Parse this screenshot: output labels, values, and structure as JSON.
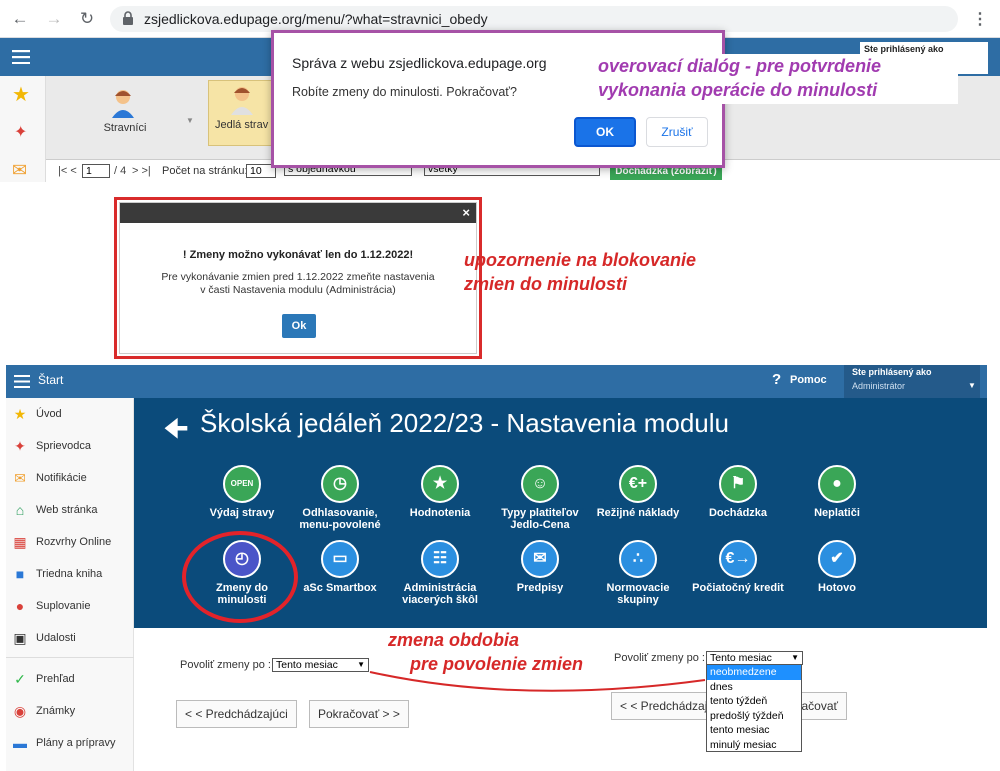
{
  "browser": {
    "url": "zsjedlickova.edupage.org/menu/?what=stravnici_obedy"
  },
  "app_top": {
    "ribbon_stravnici": "Stravníci",
    "ribbon_jedla": "Jedlá strav",
    "pager_nav": "|< <",
    "pager_page": "1",
    "pager_of": "/ 4",
    "pager_next": "> >|",
    "per_page_label": "Počet na stránku:",
    "per_page_value": "10",
    "filter1": "s objednávkou",
    "filter2": "všetky",
    "attendance_button": "Dochádzka (zobraziť)",
    "signed_in_label": "Ste prihlásený ako"
  },
  "confirm_dialog": {
    "title": "Správa z webu zsjedlickova.edupage.org",
    "message": "Robíte zmeny do minulosti. Pokračovať?",
    "ok": "OK",
    "cancel": "Zrušiť"
  },
  "annotations": {
    "confirm_line1": "overovací dialóg - pre potvrdenie",
    "confirm_line2": "vykonania operácie do minulosti",
    "warn_line1": "upozornenie na blokovanie",
    "warn_line2": "zmien do minulosti",
    "zmena_line1": "zmena obdobia",
    "zmena_line2": "pre povolenie zmien"
  },
  "warning_dialog": {
    "title": "! Zmeny možno vykonávať len do 1.12.2022!",
    "line1": "Pre vykonávanie zmien pred 1.12.2022 zmeňte nastavenia",
    "line2": "v časti Nastavenia modulu (Administrácia)",
    "ok": "Ok",
    "close": "×"
  },
  "app2": {
    "menu_label": "Štart",
    "help": "Pomoc",
    "signed_in_label": "Ste prihlásený ako",
    "signed_in_role": "Administrátor",
    "page_title": "Školská jedáleň 2022/23 - Nastavenia modulu",
    "sidebar": [
      {
        "label": "Úvod",
        "icon": "star-icon",
        "color": "#f2b705"
      },
      {
        "label": "Sprievodca",
        "icon": "wand-icon",
        "color": "#d9413a"
      },
      {
        "label": "Notifikácie",
        "icon": "envelope-icon",
        "color": "#f0a030"
      },
      {
        "label": "Web stránka",
        "icon": "home-icon",
        "color": "#2a9d5c"
      },
      {
        "label": "Rozvrhy Online",
        "icon": "grid-icon",
        "color": "#d9413a"
      },
      {
        "label": "Triedna kniha",
        "icon": "book-icon",
        "color": "#2b78d6"
      },
      {
        "label": "Suplovanie",
        "icon": "user-icon",
        "color": "#d9413a"
      },
      {
        "label": "Udalosti",
        "icon": "calendar-icon",
        "color": "#333333"
      },
      {
        "label": "Prehľad",
        "icon": "check-icon",
        "color": "#2fb84a"
      },
      {
        "label": "Známky",
        "icon": "grade-icon",
        "color": "#d9413a"
      },
      {
        "label": "Plány a prípravy",
        "icon": "briefcase-icon",
        "color": "#2b78d6"
      }
    ],
    "tiles_row1": [
      {
        "label": "Výdaj stravy",
        "icon": "open-sign-icon",
        "color": "#3aa657"
      },
      {
        "label": "Odhlasovanie, menu-povolené",
        "icon": "clock-icon",
        "color": "#3aa657"
      },
      {
        "label": "Hodnotenia",
        "icon": "star-icon",
        "color": "#3aa657"
      },
      {
        "label": "Typy platiteľov Jedlo-Cena",
        "icon": "payer-icon",
        "color": "#3aa657"
      },
      {
        "label": "Režijné náklady",
        "icon": "euro-plus-icon",
        "color": "#3aa657"
      },
      {
        "label": "Dochádzka",
        "icon": "walk-icon",
        "color": "#3aa657"
      },
      {
        "label": "Neplatiči",
        "icon": "money-bag-icon",
        "color": "#3aa657"
      }
    ],
    "tiles_row2": [
      {
        "label": "Zmeny do minulosti",
        "icon": "history-clock-icon",
        "color": "#4a55c8"
      },
      {
        "label": "aSc Smartbox",
        "icon": "monitor-icon",
        "color": "#2b8fe0"
      },
      {
        "label": "Administrácia viacerých škôl",
        "icon": "org-chart-icon",
        "color": "#2b8fe0"
      },
      {
        "label": "Predpisy",
        "icon": "payment-icon",
        "color": "#2b8fe0"
      },
      {
        "label": "Normovacie skupiny",
        "icon": "dots-icon",
        "color": "#2b8fe0"
      },
      {
        "label": "Počiatočný kredit",
        "icon": "euro-arrow-icon",
        "color": "#2b8fe0"
      },
      {
        "label": "Hotovo",
        "icon": "checkmark-icon",
        "color": "#2b8fe0"
      }
    ],
    "allow_label": "Povoliť zmeny po :",
    "allow_value": "Tento mesiac",
    "prev_button": "< < Predchádzajúci",
    "next_button": "Pokračovať > >",
    "dropdown_options": [
      "neobmedzene",
      "dnes",
      "tento týždeň",
      "predošlý týždeň",
      "tento mesiac",
      "minulý mesiac"
    ],
    "dropdown_selected": 0
  }
}
